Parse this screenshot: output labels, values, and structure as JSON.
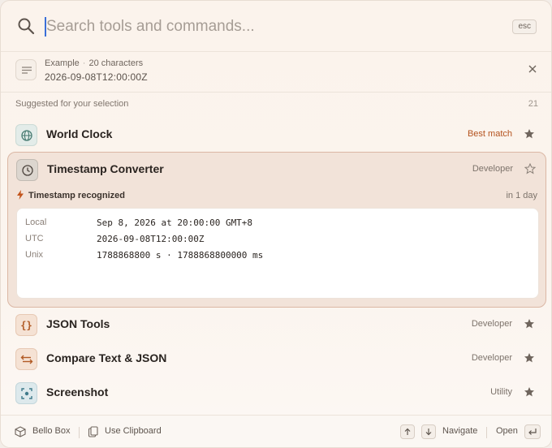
{
  "search": {
    "placeholder": "Search tools and commands...",
    "value": "",
    "esc_label": "esc"
  },
  "selection": {
    "source": "Example",
    "separator": "·",
    "length": "20 characters",
    "value": "2026-09-08T12:00:00Z"
  },
  "section": {
    "title": "Suggested for your selection",
    "count": "21"
  },
  "items": [
    {
      "name": "World Clock",
      "tag": "Best match",
      "icon": "globe-icon",
      "starred": true
    },
    {
      "name": "Timestamp Converter",
      "tag": "Developer",
      "icon": "clock-icon",
      "starred": false
    },
    {
      "name": "JSON Tools",
      "tag": "Developer",
      "icon": "braces-icon",
      "icon_text": "{}",
      "starred": true
    },
    {
      "name": "Compare Text & JSON",
      "tag": "Developer",
      "icon": "compare-arrows-icon",
      "starred": true
    },
    {
      "name": "Screenshot",
      "tag": "Utility",
      "icon": "screenshot-icon",
      "starred": true
    }
  ],
  "timestamp": {
    "recognized_label": "Timestamp recognized",
    "relative": "in 1 day",
    "rows": [
      {
        "label": "Local",
        "value": "Sep 8, 2026 at 20:00:00 GMT+8"
      },
      {
        "label": "UTC",
        "value": "2026-09-08T12:00:00Z"
      },
      {
        "label": "Unix",
        "value": "1788868800 s · 1788868800000 ms"
      }
    ]
  },
  "footer": {
    "app_name": "Bello Box",
    "clipboard_label": "Use Clipboard",
    "navigate_label": "Navigate",
    "open_label": "Open"
  },
  "colors": {
    "accent": "#b4531e",
    "caret": "#3a6fd8",
    "card_bg": "#f2e3d9",
    "card_border": "#dbb7a4"
  }
}
